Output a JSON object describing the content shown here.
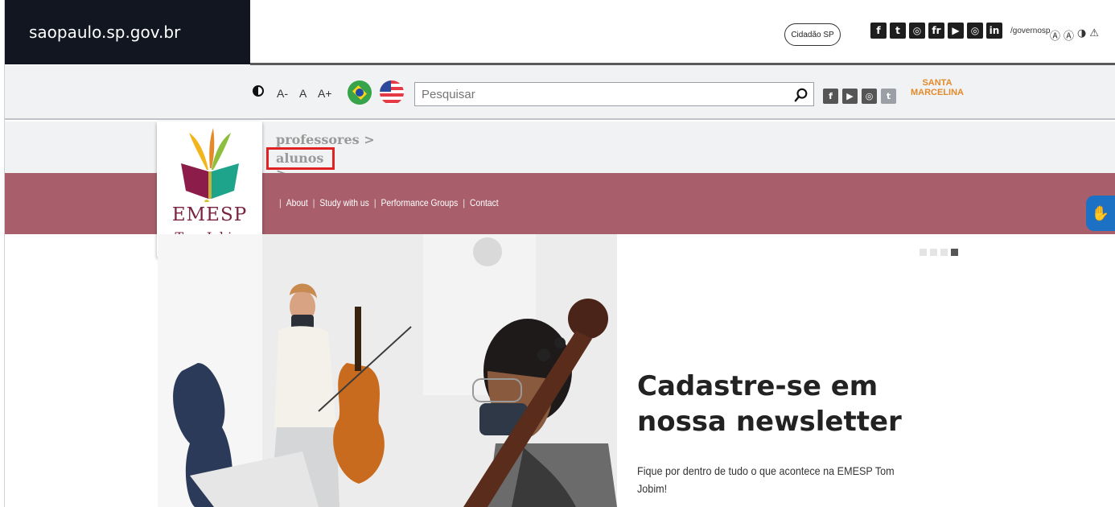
{
  "gov_bar": {
    "brand": "saopaulo.sp.gov.br",
    "cidadao_button": "Cidadão SP",
    "social_icons": [
      "facebook-icon",
      "twitter-icon",
      "instagram-icon",
      "flickr-icon",
      "youtube-icon",
      "instagram-icon",
      "linkedin-icon"
    ],
    "social_glyphs": [
      "f",
      "t",
      "◎",
      "fr",
      "▶",
      "◎",
      "in"
    ],
    "handle": "/governosp",
    "accessibility_icons": [
      "Ⓐ",
      "Ⓐ",
      "◑",
      "⚠"
    ]
  },
  "toolbar": {
    "font_small": "A-",
    "font_normal": "A",
    "font_large": "A+",
    "search_placeholder": "Pesquisar",
    "social_glyphs": [
      "f",
      "▶",
      "◎",
      "t"
    ],
    "partner_logo_line1": "SANTA",
    "partner_logo_line2": "MARCELINA"
  },
  "breadcrumb": {
    "item1": "professores >",
    "item2": "alunos >"
  },
  "logo": {
    "line1": "EMESP",
    "line2": "Tom Jobim"
  },
  "nav": {
    "items": [
      "About",
      "Study with us",
      "Performance Groups",
      "Contact"
    ]
  },
  "vlibras_icon": "✋",
  "slider": {
    "total": 4,
    "active_index": 3
  },
  "newsletter": {
    "title": "Cadastre-se em nossa newsletter",
    "text": "Fique por dentro de tudo o que acontece na EMESP Tom Jobim!"
  },
  "colors": {
    "nav_band": "#a85f6b",
    "brand_dark": "#121621",
    "highlight": "#e02222",
    "logo_text": "#7a2340"
  }
}
